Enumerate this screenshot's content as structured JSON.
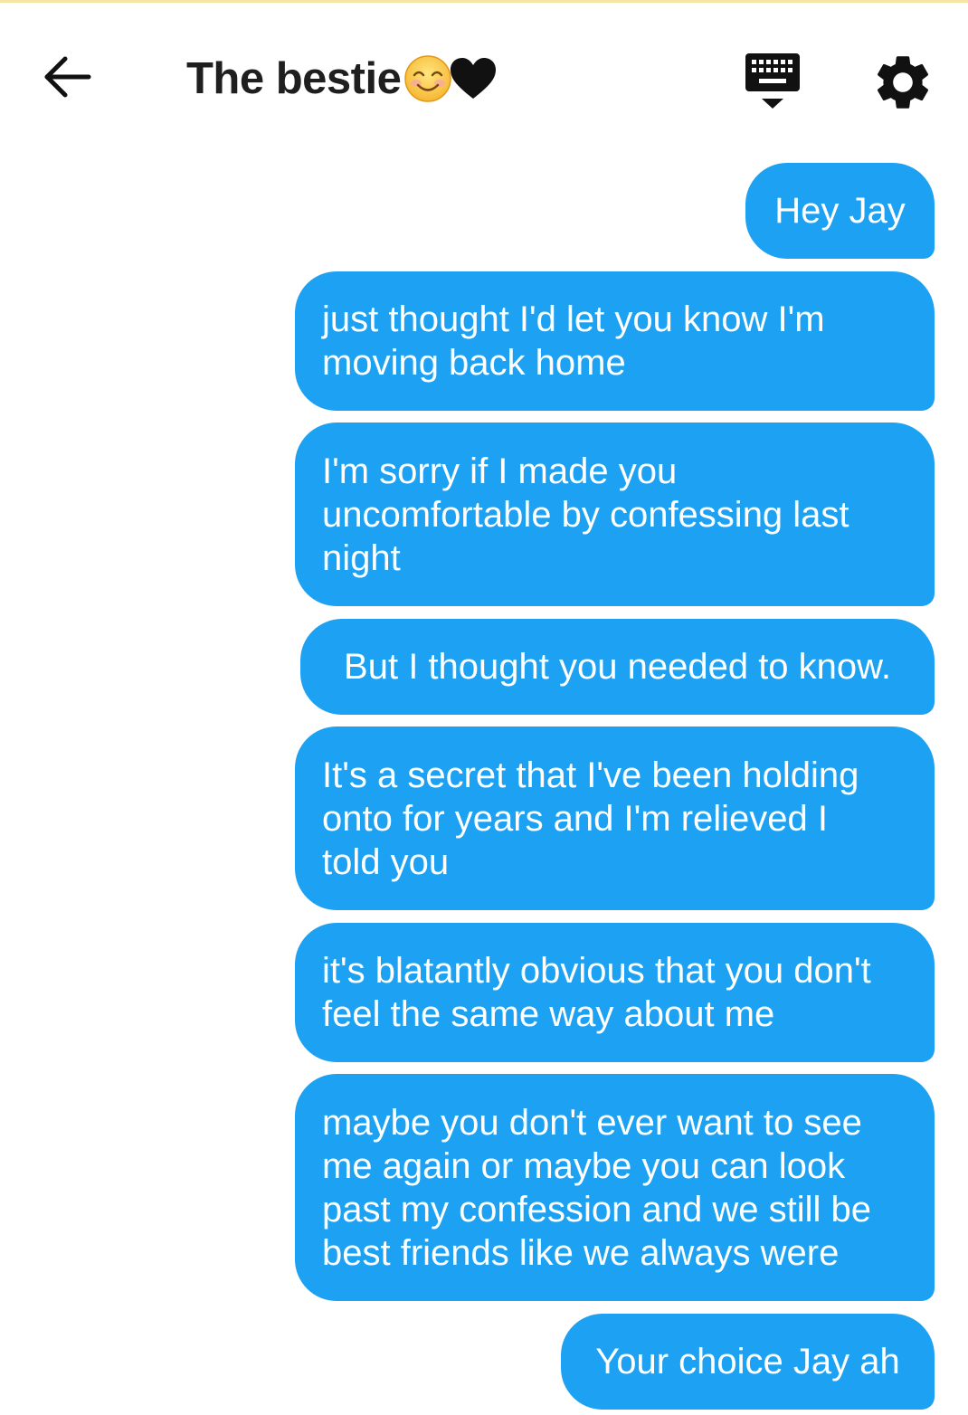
{
  "header": {
    "title": "The bestie",
    "title_emojis": [
      "smiling-face-emoji",
      "black-heart-emoji"
    ],
    "back_icon": "arrow-left-icon",
    "keyboard_icon": "keyboard-hide-icon",
    "settings_icon": "gear-icon"
  },
  "colors": {
    "bubble_bg": "#1da1f2",
    "bubble_text": "#ffffff",
    "header_text": "#1f1f1f",
    "background": "#ffffff",
    "top_strip": "#f5e6a6"
  },
  "messages": [
    {
      "text": "Hey Jay"
    },
    {
      "text": "just thought I'd let you know I'm\nmoving back home"
    },
    {
      "text": "I'm sorry if I made you\nuncomfortable by confessing last\nnight"
    },
    {
      "text": "But I thought you needed to know."
    },
    {
      "text": "It's a secret that I've been holding\nonto for years and I'm relieved I\ntold you"
    },
    {
      "text": "it's blatantly obvious that you don't\nfeel the same way about me"
    },
    {
      "text": "maybe you don't ever want to see\nme again or maybe you can look\npast my confession and we still be\nbest friends like we always were"
    },
    {
      "text": "Your choice Jay ah"
    }
  ]
}
